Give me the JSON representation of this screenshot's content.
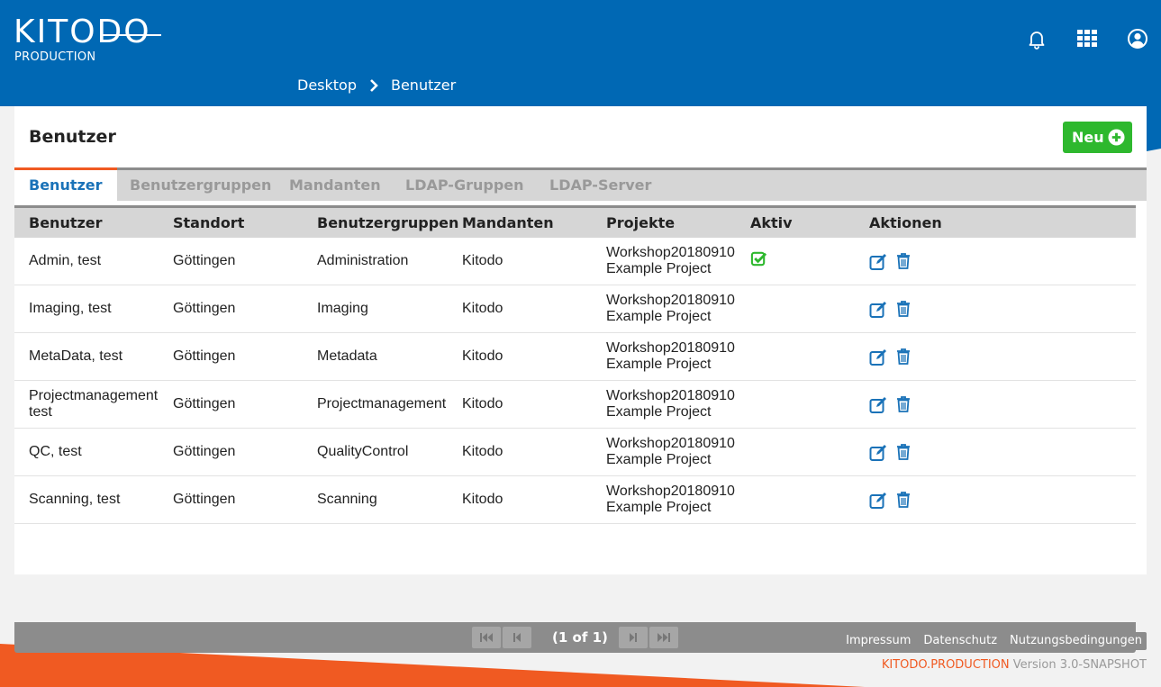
{
  "app": {
    "logo_text": "KITODO",
    "logo_sub": "PRODUCTION",
    "colors": {
      "brand_blue": "#0068b4",
      "accent_orange": "#f05a22",
      "success_green": "#2eb82e",
      "link_blue": "#1a72b8"
    }
  },
  "header": {
    "icons": [
      "bell-icon",
      "apps-grid-icon",
      "user-account-icon"
    ]
  },
  "breadcrumb": {
    "items": [
      "Desktop",
      "Benutzer"
    ]
  },
  "page": {
    "title": "Benutzer",
    "new_button": "Neu"
  },
  "tabs": [
    {
      "label": "Benutzer",
      "active": true
    },
    {
      "label": "Benutzergruppen",
      "active": false
    },
    {
      "label": "Mandanten",
      "active": false
    },
    {
      "label": "LDAP-Gruppen",
      "active": false
    },
    {
      "label": "LDAP-Server",
      "active": false
    }
  ],
  "table": {
    "columns": [
      "Benutzer",
      "Standort",
      "Benutzergruppen",
      "Mandanten",
      "Projekte",
      "Aktiv",
      "Aktionen"
    ],
    "rows": [
      {
        "user": "Admin, test",
        "location": "Göttingen",
        "groups": "Administration",
        "client": "Kitodo",
        "projects": [
          "Workshop20180910",
          "Example Project"
        ],
        "active": true
      },
      {
        "user": "Imaging, test",
        "location": "Göttingen",
        "groups": "Imaging",
        "client": "Kitodo",
        "projects": [
          "Workshop20180910",
          "Example Project"
        ],
        "active": false
      },
      {
        "user": "MetaData, test",
        "location": "Göttingen",
        "groups": "Metadata",
        "client": "Kitodo",
        "projects": [
          "Workshop20180910",
          "Example Project"
        ],
        "active": false
      },
      {
        "user": "Projectmanagement test",
        "location": "Göttingen",
        "groups": "Projectmanagement",
        "client": "Kitodo",
        "projects": [
          "Workshop20180910",
          "Example Project"
        ],
        "active": false
      },
      {
        "user": "QC, test",
        "location": "Göttingen",
        "groups": "QualityControl",
        "client": "Kitodo",
        "projects": [
          "Workshop20180910",
          "Example Project"
        ],
        "active": false
      },
      {
        "user": "Scanning, test",
        "location": "Göttingen",
        "groups": "Scanning",
        "client": "Kitodo",
        "projects": [
          "Workshop20180910",
          "Example Project"
        ],
        "active": false
      }
    ]
  },
  "paginator": {
    "text": "(1 of 1)"
  },
  "footer": {
    "links": [
      "Impressum",
      "Datenschutz",
      "Nutzungsbedingungen"
    ],
    "brand": "KITODO.PRODUCTION",
    "version": "Version 3.0-SNAPSHOT"
  }
}
